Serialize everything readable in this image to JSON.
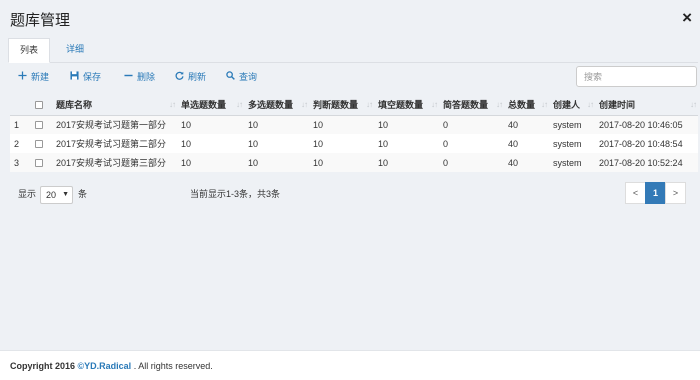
{
  "header": {
    "title": "题库管理",
    "close_glyph": "×"
  },
  "tabs": [
    {
      "label": "列表",
      "active": true
    },
    {
      "label": "详细",
      "active": false
    }
  ],
  "toolbar": {
    "new_label": "新建",
    "save_label": "保存",
    "delete_label": "删除",
    "refresh_label": "刷新",
    "query_label": "查询"
  },
  "search": {
    "placeholder": "搜索",
    "value": ""
  },
  "table": {
    "columns": [
      "题库名称",
      "单选题数量",
      "多选题数量",
      "判断题数量",
      "填空题数量",
      "简答题数量",
      "总数量",
      "创建人",
      "创建时间"
    ],
    "rows": [
      [
        "1",
        "2017安规考试习题第一部分",
        "10",
        "10",
        "10",
        "10",
        "0",
        "40",
        "system",
        "2017-08-20 10:46:05"
      ],
      [
        "2",
        "2017安规考试习题第二部分",
        "10",
        "10",
        "10",
        "10",
        "0",
        "40",
        "system",
        "2017-08-20 10:48:54"
      ],
      [
        "3",
        "2017安规考试习题第三部分",
        "10",
        "10",
        "10",
        "10",
        "0",
        "40",
        "system",
        "2017-08-20 10:52:24"
      ]
    ]
  },
  "pagination": {
    "show_label": "显示",
    "page_size": "20",
    "unit_label": "条",
    "summary": "当前显示1-3条，共3条",
    "prev": "<",
    "current": "1",
    "next": ">"
  },
  "footer": {
    "prefix": "Copyright 2016 ",
    "brand": "©YD.Radical",
    "suffix": " . All rights reserved."
  },
  "colors": {
    "accent": "#2a7ab8",
    "active_page": "#337ab7",
    "background": "#eef1f5"
  }
}
